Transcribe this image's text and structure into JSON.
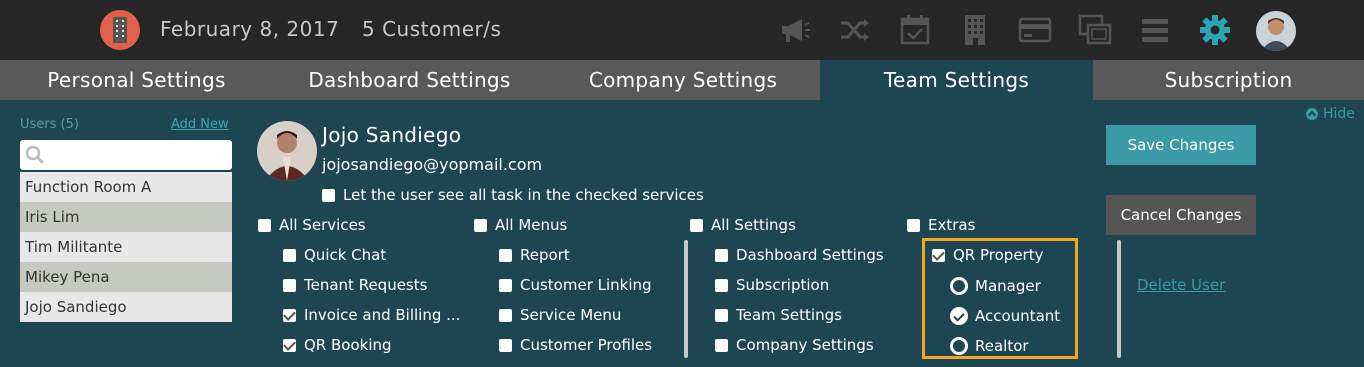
{
  "header": {
    "date": "February 8, 2017",
    "customers": "5 Customer/s",
    "icons": [
      "logo-building-icon",
      "megaphone-icon",
      "shuffle-icon",
      "calendar-check-icon",
      "building-icon",
      "credit-card-icon",
      "screens-icon",
      "menu-icon",
      "gear-icon",
      "user-avatar"
    ],
    "accent": "#2aa3b5"
  },
  "tabs": [
    {
      "label": "Personal Settings"
    },
    {
      "label": "Dashboard Settings"
    },
    {
      "label": "Company Settings"
    },
    {
      "label": "Team Settings"
    },
    {
      "label": "Subscription"
    }
  ],
  "users_panel": {
    "title": "Users (5)",
    "add_new": "Add New",
    "search_placeholder": "",
    "users": [
      "Function Room A",
      "Iris Lim",
      "Tim Militante",
      "Mikey Pena",
      "Jojo Sandiego"
    ]
  },
  "selected_user": {
    "name": "Jojo Sandiego",
    "email": "jojosandiego@yopmail.com",
    "see_all_tasks": "Let the user see all task in the checked services"
  },
  "columns": {
    "services": {
      "header": "All Services",
      "items": [
        {
          "label": "Quick Chat",
          "checked": false
        },
        {
          "label": "Tenant Requests",
          "checked": false
        },
        {
          "label": "Invoice and Billing ...",
          "checked": true
        },
        {
          "label": "QR Booking",
          "checked": true
        }
      ]
    },
    "menus": {
      "header": "All Menus",
      "items": [
        {
          "label": "Report",
          "checked": false
        },
        {
          "label": "Customer Linking",
          "checked": false
        },
        {
          "label": "Service Menu",
          "checked": false
        },
        {
          "label": "Customer Profiles",
          "checked": false
        }
      ]
    },
    "settings": {
      "header": "All Settings",
      "items": [
        {
          "label": "Dashboard Settings",
          "checked": false
        },
        {
          "label": "Subscription",
          "checked": false
        },
        {
          "label": "Team Settings",
          "checked": false
        },
        {
          "label": "Company Settings",
          "checked": false
        }
      ]
    },
    "extras": {
      "header": "Extras",
      "qr_property": "QR Property",
      "roles": [
        {
          "label": "Manager",
          "selected": false
        },
        {
          "label": "Accountant",
          "selected": true
        },
        {
          "label": "Realtor",
          "selected": false
        }
      ]
    }
  },
  "actions": {
    "save": "Save Changes",
    "cancel": "Cancel Changes",
    "delete": "Delete User",
    "hide": "Hide"
  }
}
